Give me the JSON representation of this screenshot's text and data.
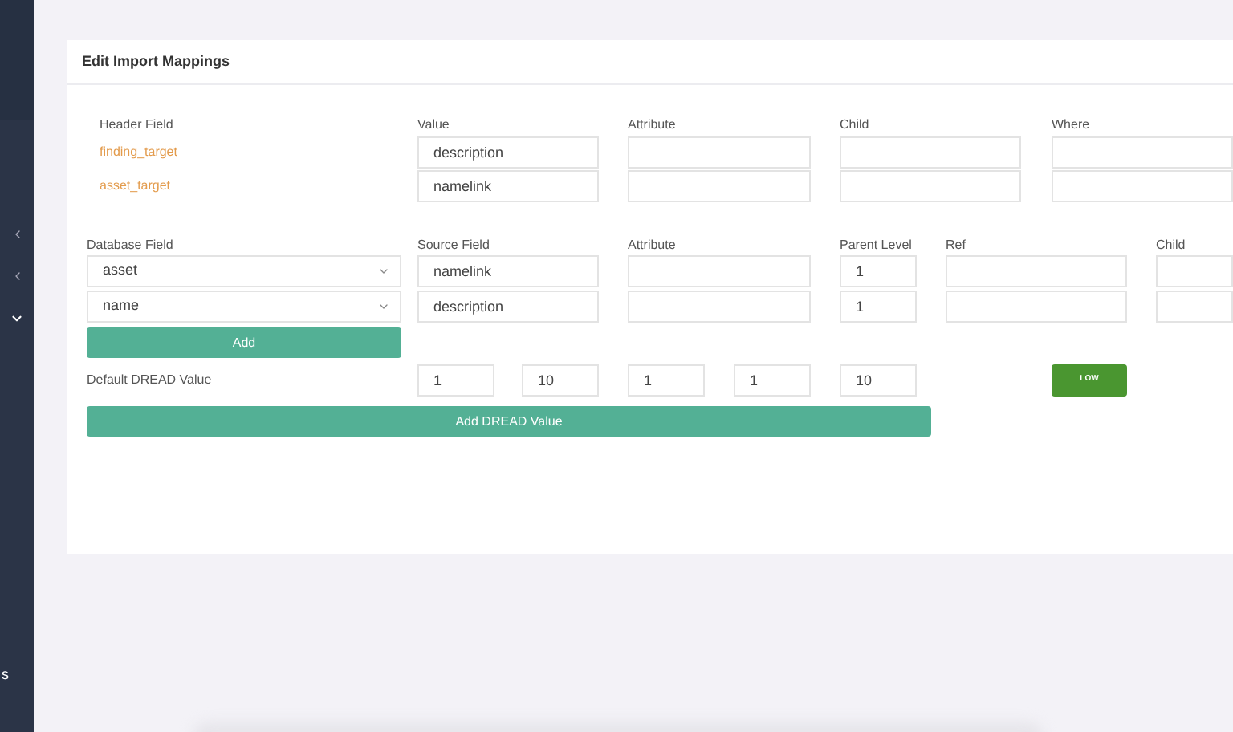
{
  "sidebar": {
    "items": [
      {
        "expanded": false
      },
      {
        "expanded": false
      },
      {
        "expanded": true
      }
    ],
    "footer_text": "s"
  },
  "card": {
    "title": "Edit Import Mappings",
    "header_section": {
      "columns": [
        "Header Field",
        "Value",
        "Attribute",
        "Child",
        "Where"
      ],
      "rows": [
        {
          "field": "finding_target",
          "value": "description"
        },
        {
          "field": "asset_target",
          "value": "namelink"
        }
      ]
    },
    "database_section": {
      "columns": [
        "Database Field",
        "Source Field",
        "Attribute",
        "Parent Level",
        "Ref",
        "Child"
      ],
      "rows": [
        {
          "database_field": "asset",
          "source_field": "namelink",
          "parent_level": "1"
        },
        {
          "database_field": "name",
          "source_field": "description",
          "parent_level": "1"
        }
      ]
    },
    "add_button": "Add",
    "dread": {
      "label": "Default DREAD Value",
      "values": [
        "1",
        "10",
        "1",
        "1",
        "10"
      ],
      "rating": "LOW"
    },
    "add_dread_button": "Add DREAD Value"
  }
}
